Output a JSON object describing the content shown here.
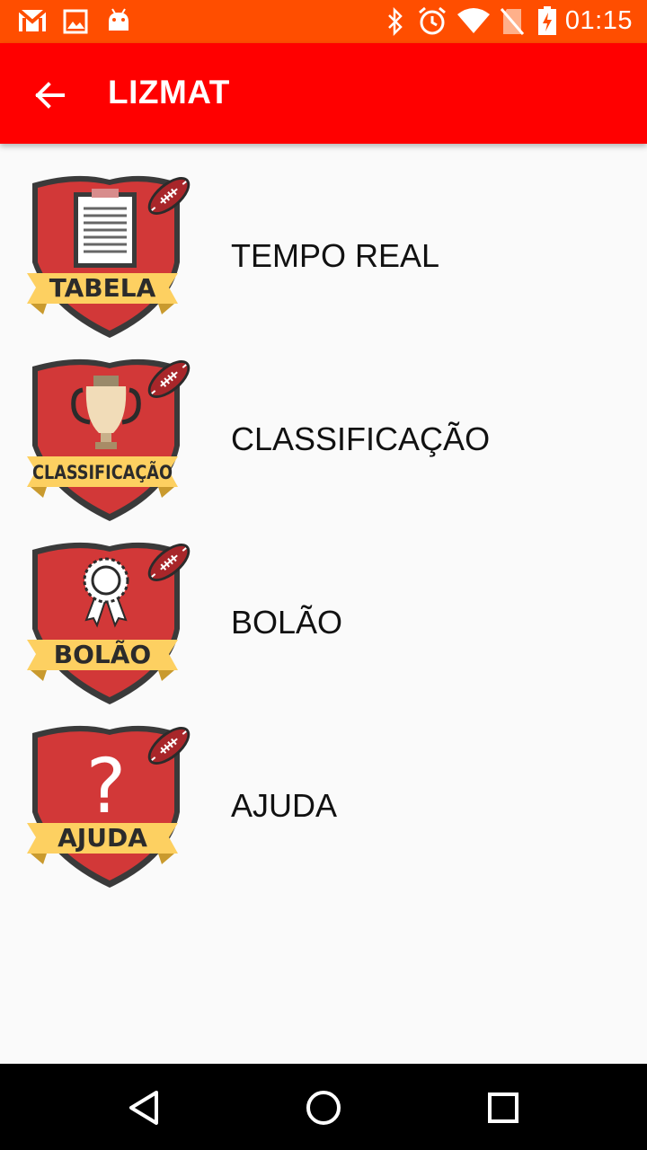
{
  "status_bar": {
    "time": "01:15",
    "icons": [
      "gmail-icon",
      "image-icon",
      "android-icon",
      "bluetooth-icon",
      "alarm-icon",
      "wifi-icon",
      "no-sim-icon",
      "battery-charging-icon"
    ]
  },
  "app_bar": {
    "title": "LIZMAT",
    "back_icon": "arrow-left-icon"
  },
  "menu": {
    "items": [
      {
        "label": "TEMPO REAL",
        "badge_text": "TABELA",
        "badge_icon": "clipboard-icon"
      },
      {
        "label": "CLASSIFICAÇÃO",
        "badge_text": "CLASSIFICAÇÃO",
        "badge_icon": "trophy-icon"
      },
      {
        "label": "BOLÃO",
        "badge_text": "BOLÃO",
        "badge_icon": "award-ribbon-icon"
      },
      {
        "label": "AJUDA",
        "badge_text": "AJUDA",
        "badge_icon": "question-mark-icon"
      }
    ]
  },
  "nav_bar": {
    "icons": [
      "back-triangle-icon",
      "home-circle-icon",
      "recents-square-icon"
    ]
  },
  "colors": {
    "status_bar": "#ff4e00",
    "app_bar": "#ff0000",
    "shield": "#d23232",
    "banner": "#fdd061"
  }
}
